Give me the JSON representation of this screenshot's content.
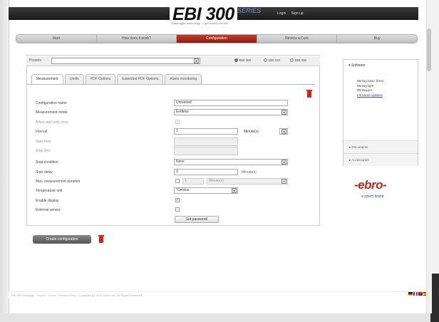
{
  "header": {
    "logo": "EBI 300",
    "logo_suffix": "SERIES",
    "tagline": "Datalogger technology — you check the rest",
    "links": [
      "Login",
      "Sign up"
    ]
  },
  "nav": {
    "tabs": [
      "Start",
      "How does it work?",
      "Configuration",
      "Review a Cure",
      "Buy"
    ],
    "active_index": 2
  },
  "status": {
    "label": "Presets",
    "selected": "",
    "radios": [
      {
        "label": "EBI 300",
        "checked": true
      },
      {
        "label": "EBI 310",
        "checked": false
      },
      {
        "label": "EBI 330",
        "checked": false
      }
    ]
  },
  "subtabs": [
    "Measurement",
    "Limits",
    "PDF Options",
    "Extended PDF Options",
    "Alarm monitoring"
  ],
  "form": {
    "config_name": {
      "label": "Configuration name",
      "value": "Unnamed"
    },
    "measurement_mode": {
      "label": "Measurement mode",
      "value": "Endless"
    },
    "allow_start_once": {
      "label": "Allow start only once"
    },
    "interval": {
      "label": "Interval",
      "value": "1",
      "unit": "Minute(s)"
    },
    "start_time": {
      "label": "Start time"
    },
    "stop_time": {
      "label": "Stop time"
    },
    "stop_condition": {
      "label": "Stop condition",
      "value": "None"
    },
    "start_delay": {
      "label": "Start delay",
      "value": "0",
      "unit": "Minute(s)"
    },
    "max_duration": {
      "label": "Max. measurement duration",
      "value": "1",
      "unit": "Minute(s)"
    },
    "temp_unit": {
      "label": "Temperature unit",
      "value": "°Celsius"
    },
    "enable_display": {
      "label": "Enable display"
    },
    "external_sensor": {
      "label": "External sensor"
    },
    "set_password": "Set password"
  },
  "create_button": "Create configuration",
  "sidebar": {
    "software_title": "Software",
    "software_items": [
      "Winlog.basic (free)",
      "Winlog.light",
      "Winlog.pro",
      "Firmware updates"
    ],
    "sections": [
      "Documents",
      "Accessories"
    ],
    "brand": "-ebro-",
    "brand_sub": "a xylem brand"
  },
  "footer": {
    "text": "EBI 300 Webpage · Imprint · Terms · Privacy Policy · Copyright (c) 2014 Xylem Inc. All Rights Reserved."
  },
  "colors": {
    "accent": "#b0301f",
    "brand_red": "#c3281c",
    "link_blue": "#2c4fa4"
  }
}
